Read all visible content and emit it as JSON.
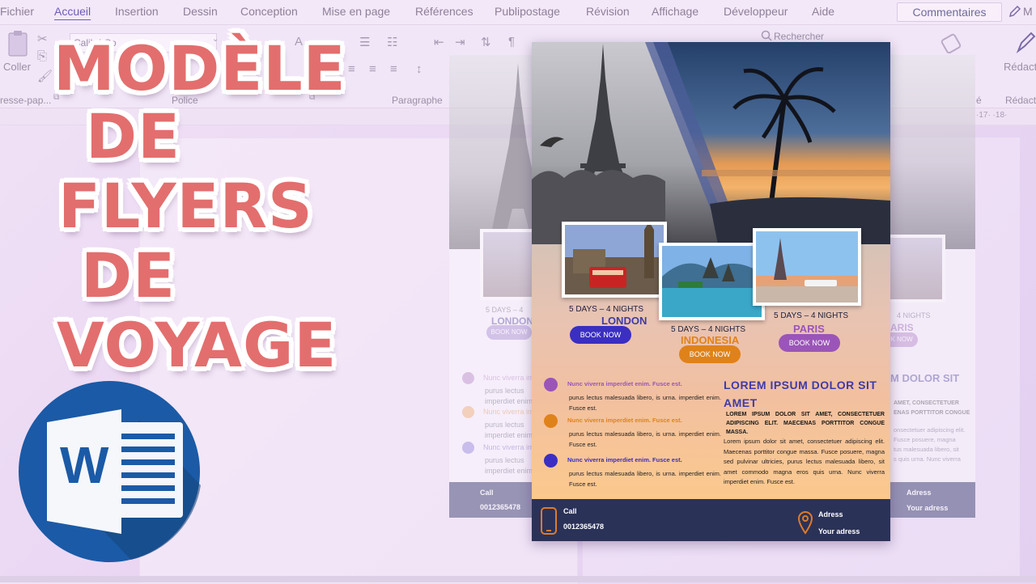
{
  "menu": {
    "items": [
      "Fichier",
      "Accueil",
      "Insertion",
      "Dessin",
      "Conception",
      "Mise en page",
      "Références",
      "Publipostage",
      "Révision",
      "Affichage",
      "Développeur",
      "Aide"
    ],
    "active": "Accueil",
    "comments": "Commentaires",
    "edit_partial": "M"
  },
  "ribbon": {
    "coller": "Coller",
    "font_name": "Calibri Co",
    "clipboard_group": "resse-pap...",
    "police_group": "Police",
    "paragraphe_group": "Paragraphe",
    "search": "Rechercher",
    "redaction": "Rédacti",
    "redaction_group": "Rédacte",
    "group_partial": "é",
    "ruler_nums": "·17· ·18·"
  },
  "overlay_title": {
    "lines": [
      "MODÈLE",
      "DE",
      "FLYERS",
      "DE",
      "VOYAGE"
    ],
    "color": "#e36e6e"
  },
  "word_logo": {
    "letter": "W",
    "icon": "word-icon",
    "bg": "#1b5aa6"
  },
  "flyer": {
    "destinations": [
      {
        "nights": "5 DAYS – 4 NIGHTS",
        "city": "LONDON",
        "button": "BOOK NOW",
        "city_color": "#3f3aa9",
        "button_color": "#3a2fc0"
      },
      {
        "nights": "5 DAYS – 4 NIGHTS",
        "city": "INDONESIA",
        "button": "BOOK NOW",
        "city_color": "#e0821a",
        "button_color": "#e0821a"
      },
      {
        "nights": "5 DAYS – 4 NIGHTS",
        "city": "PARIS",
        "button": "BOOK NOW",
        "city_color": "#9b55b8",
        "button_color": "#9b55b8"
      }
    ],
    "list": [
      {
        "title": "Nunc viverra imperdiet enim. Fusce est.",
        "body": "purus lectus malesuada libero, is urna. imperdiet enim. Fusce est.",
        "color": "#9b55b8"
      },
      {
        "title": "Nunc viverra imperdiet enim. Fusce est.",
        "body": "purus lectus malesuada libero, is urna. imperdiet enim. Fusce est.",
        "color": "#e0821a"
      },
      {
        "title": "Nunc viverra imperdiet enim. Fusce est.",
        "body": "purus lectus malesuada libero, is urna. imperdiet enim. Fusce est.",
        "color": "#3a2fc0"
      }
    ],
    "lorem_title": "LOREM IPSUM DOLOR SIT AMET",
    "lorem_caps": "LOREM IPSUM DOLOR SIT AMET, CONSECTETUER ADIPISCING ELIT. MAECENAS PORTTITOR CONGUE MASSA.",
    "lorem_body": "Lorem ipsum dolor sit amet, consectetuer adipiscing elit. Maecenas porttitor congue massa. Fusce posuere, magna sed pulvinar ultricies, purus lectus malesuada libero, sit amet commodo magna eros quis urna. Nunc viverra imperdiet enim. Fusce est.",
    "footer": {
      "call_label": "Call",
      "phone": "0012365478",
      "address_label": "Adress",
      "address": "Your adress"
    }
  },
  "ghost_left": {
    "nights": "5 DAYS – 4",
    "city": "LONDON",
    "button": "BOOK NOW",
    "list_title": "Nunc viverra imperd",
    "list_body_1": "purus lectus",
    "list_body_2": "imperdiet enim.",
    "call_label": "Call",
    "phone": "0012365478"
  },
  "ghost_right": {
    "nights": "4 NIGHTS",
    "city": "ARIS",
    "button": "OK NOW",
    "lorem_title": "M DOLOR SIT",
    "line1": "AMET, CONSECTETUER",
    "line2": "ENAS PORTTITOR CONGUE",
    "line3": "onsectetuer adipiscing elit.",
    "line4": "Fusce posuere, magna",
    "line5": "tus malesuada libero, sit",
    "line6": "s quis urna. Nunc viverra",
    "address_label": "Adress",
    "address": "Your adress"
  }
}
